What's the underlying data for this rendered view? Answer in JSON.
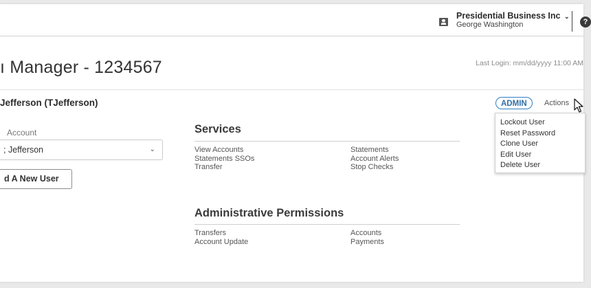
{
  "header": {
    "org_name": "Presidential Business Inc",
    "org_chevron": "⌄",
    "user_name": "George Washington",
    "help_glyph": "?"
  },
  "page": {
    "title": "ı Manager - 1234567",
    "last_login": "Last Login: mm/dd/yyyy 11:00 AM"
  },
  "user_header": {
    "name": "Jefferson (TJefferson)",
    "badge": "ADMIN",
    "actions_label": "Actions",
    "actions_caret": "⌄"
  },
  "actions_menu": {
    "items": [
      {
        "label": "Lockout User"
      },
      {
        "label": "Reset Password"
      },
      {
        "label": "Clone User"
      },
      {
        "label": "Edit User"
      },
      {
        "label": "Delete User"
      }
    ]
  },
  "account": {
    "label": "Account",
    "value": "; Jefferson",
    "chevron": "⌄"
  },
  "add_user": {
    "label": "d A New User"
  },
  "services": {
    "title": "Services",
    "left": [
      "View Accounts",
      "Statements SSOs",
      "Transfer"
    ],
    "right": [
      "Statements",
      "Account Alerts",
      "Stop Checks"
    ]
  },
  "admin_perms": {
    "title": "Administrative Permissions",
    "left": [
      "Transfers",
      "Account Update"
    ],
    "right": [
      "Accounts",
      "Payments"
    ]
  },
  "colors": {
    "accent": "#2e7fc4",
    "background": "#e9e9ea"
  },
  "icons": {
    "org": "building-user-icon",
    "help": "help-icon",
    "cursor": "mouse-pointer-icon"
  }
}
